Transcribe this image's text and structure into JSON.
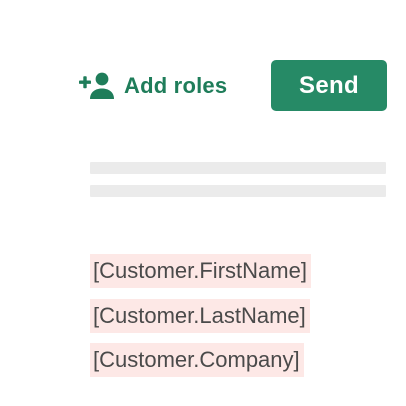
{
  "toolbar": {
    "add_roles": {
      "label": "Add roles",
      "icon": "add-person-icon"
    },
    "send_label": "Send"
  },
  "colors": {
    "accent_green": "#268a66",
    "add_roles_text": "#1f7d5a",
    "merge_field_bg": "#fde8e6",
    "placeholder_line": "#ebebeb"
  },
  "document": {
    "merge_fields": [
      "[Customer.FirstName]",
      "[Customer.LastName]",
      "[Customer.Company]"
    ]
  }
}
